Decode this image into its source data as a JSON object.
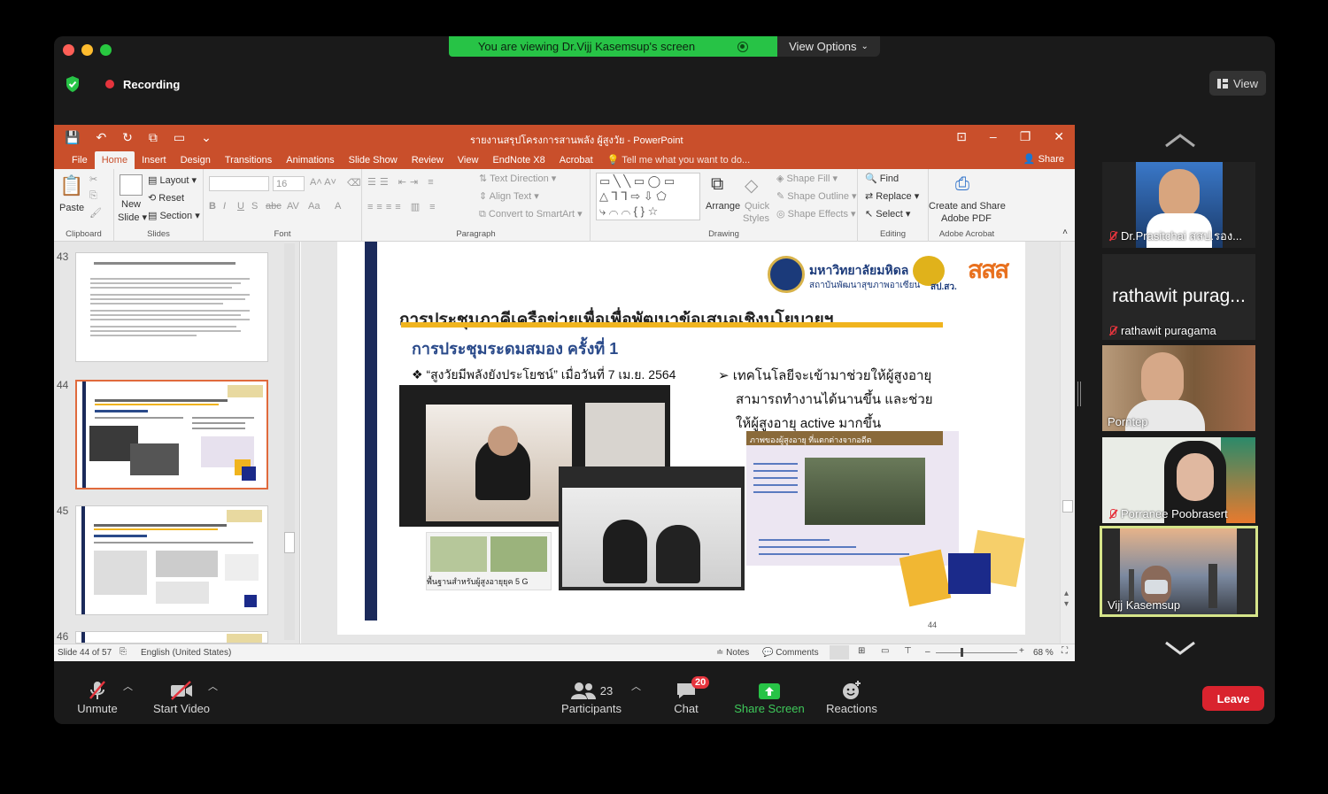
{
  "banner": {
    "text": "You are viewing Dr.Vijj Kasemsup's screen",
    "view_options": "View Options"
  },
  "recording": {
    "label": "Recording"
  },
  "view_button": {
    "label": "View"
  },
  "ppt": {
    "title": "รายงานสรุปโครงการสานพลัง ผู้สูงวัย - PowerPoint",
    "tabs": [
      "File",
      "Home",
      "Insert",
      "Design",
      "Transitions",
      "Animations",
      "Slide Show",
      "Review",
      "View",
      "EndNote X8",
      "Acrobat",
      "Tell me what you want to do..."
    ],
    "share": "Share",
    "ribbon": {
      "clipboard": {
        "paste": "Paste",
        "label": "Clipboard"
      },
      "slides": {
        "new_slide": "New",
        "new_slide2": "Slide",
        "layout": "Layout",
        "reset": "Reset",
        "section": "Section",
        "label": "Slides"
      },
      "font": {
        "size": "16",
        "label": "Font"
      },
      "paragraph": {
        "text_direction": "Text Direction",
        "align_text": "Align Text",
        "convert": "Convert to SmartArt",
        "label": "Paragraph"
      },
      "drawing": {
        "arrange": "Arrange",
        "quick": "Quick",
        "styles": "Styles",
        "shape_fill": "Shape Fill",
        "shape_outline": "Shape Outline",
        "shape_effects": "Shape Effects",
        "label": "Drawing"
      },
      "editing": {
        "find": "Find",
        "replace": "Replace",
        "select": "Select",
        "label": "Editing"
      },
      "acrobat": {
        "create": "Create and Share",
        "pdf": "Adobe PDF",
        "label": "Adobe Acrobat"
      }
    },
    "thumbnails": [
      {
        "num": "43"
      },
      {
        "num": "44"
      },
      {
        "num": "45"
      },
      {
        "num": "46"
      }
    ],
    "slide": {
      "org_name": "มหาวิทยาลัยมหิดล",
      "org_sub": "สถาบันพัฒนาสุขภาพอาเซียน",
      "logo_sub": "สป.สว.",
      "logo_text": "สสส",
      "title": "การประชุมภาคีเครือข่ายเพื่อเพื่อพัฒนาข้อเสนอเชิงนโยบายฯ",
      "subtitle": "การประชุมระดมสมอง ครั้งที่ 1",
      "bullet1": "“สูงวัยมีพลังยังประโยชน์” เมื่อวันที่ 7 เม.ย. 2564",
      "bullet2_l1": "เทคโนโลยีจะเข้ามาช่วยให้ผู้สูงอายุ",
      "bullet2_l2": "สามารถทำงานได้นานขึ้น และช่วย",
      "bullet2_l3": "ให้ผู้สูงอายุ active มากขึ้น",
      "caption": "พื้นฐานสำหรับผู้สูงอายุยุค 5 G",
      "infobox_title": "ภาพของผู้สูงอายุ ที่แตกต่างจากอดีต",
      "page_num": "44"
    },
    "status": {
      "slide_info": "Slide 44 of 57",
      "language": "English (United States)",
      "notes": "Notes",
      "comments": "Comments",
      "zoom": "68 %"
    }
  },
  "participants_gallery": [
    {
      "name": "Dr.Prasitchai สสป.รอง...",
      "muted": true
    },
    {
      "name": "rathawit puragama",
      "big_name": "rathawit purag...",
      "muted": true
    },
    {
      "name": "Porntep",
      "muted": false
    },
    {
      "name": "Porranee Poobrasert",
      "muted": true
    },
    {
      "name": "Vijj Kasemsup",
      "muted": false,
      "active": true
    }
  ],
  "toolbar": {
    "unmute": "Unmute",
    "start_video": "Start Video",
    "participants": "Participants",
    "participants_count": "23",
    "chat": "Chat",
    "chat_badge": "20",
    "share_screen": "Share Screen",
    "reactions": "Reactions",
    "leave": "Leave"
  },
  "colors": {
    "ppt_accent": "#c94f2b",
    "share_green": "#27c346",
    "leave_red": "#d9232e",
    "active_tile": "#d6e58a"
  }
}
